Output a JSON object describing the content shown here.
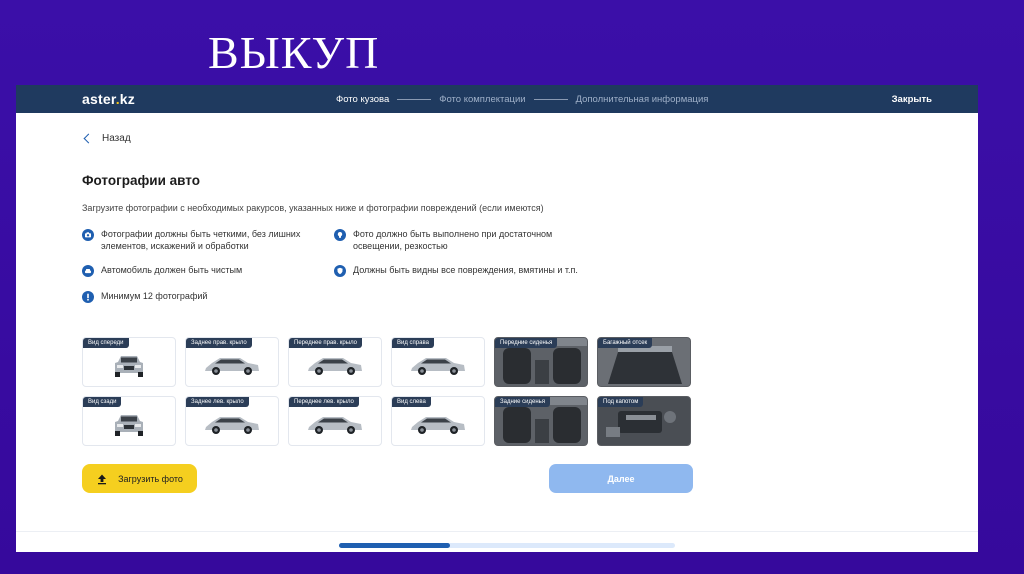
{
  "slide_title": "ВЫКУП",
  "header": {
    "logo_main": "aster",
    "logo_dot": ".",
    "logo_tld": "kz",
    "steps": [
      {
        "label": "Фото кузова",
        "active": true
      },
      {
        "label": "Фото комплектации",
        "active": false
      },
      {
        "label": "Дополнительная информация",
        "active": false
      }
    ],
    "close_label": "Закрыть"
  },
  "back_label": "Назад",
  "heading": "Фотографии авто",
  "subtext": "Загрузите фотографии с необходимых ракурсов, указанных ниже и фотографии повреждений (если имеются)",
  "rules": [
    {
      "icon": "camera-icon",
      "text": "Фотографии должны быть четкими, без лишних элементов, искажений и обработки"
    },
    {
      "icon": "lightbulb-icon",
      "text": "Фото должно быть выполнено при достаточном освещении, резкостью"
    },
    {
      "icon": "car-wash-icon",
      "text": "Автомобиль должен быть чистым"
    },
    {
      "icon": "shield-icon",
      "text": "Должны быть видны все повреждения, вмятины и т.п."
    },
    {
      "icon": "exclamation-icon",
      "text": "Минимум 12 фотографий"
    }
  ],
  "photos": [
    {
      "label": "Вид спереди",
      "kind": "front"
    },
    {
      "label": "Заднее прав. крыло",
      "kind": "rear-right"
    },
    {
      "label": "Переднее прав. крыло",
      "kind": "front-right"
    },
    {
      "label": "Вид справа",
      "kind": "side"
    },
    {
      "label": "Передние сиденья",
      "kind": "interior"
    },
    {
      "label": "Багажный отсек",
      "kind": "trunk"
    },
    {
      "label": "Вид сзади",
      "kind": "rear"
    },
    {
      "label": "Заднее лев. крыло",
      "kind": "rear-left"
    },
    {
      "label": "Переднее лев. крыло",
      "kind": "front-left"
    },
    {
      "label": "Вид слева",
      "kind": "side"
    },
    {
      "label": "Задние сиденья",
      "kind": "interior"
    },
    {
      "label": "Под капотом",
      "kind": "engine"
    }
  ],
  "upload_label": "Загрузить фото",
  "next_label": "Далее",
  "progress": 0.33,
  "colors": {
    "accent": "#1f5fb0",
    "header_bg": "#1f3a5f",
    "upload_button": "#f5cf1f",
    "next_button": "#8fb8ef",
    "slide_bg": "#3a0ca3"
  }
}
